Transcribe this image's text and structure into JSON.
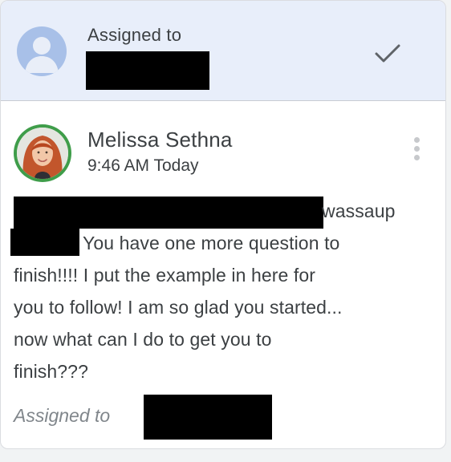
{
  "header": {
    "assigned_label": "Assigned to",
    "avatar_icon": "person-icon",
    "done_icon": "checkmark-icon"
  },
  "comment": {
    "author": "Melissa Sethna",
    "timestamp": "9:46 AM Today",
    "more_icon": "more-vert-icon",
    "message_lines": [
      " wassaup",
      "You have one more question to",
      "finish!!!! I put the example in here for",
      "you to follow! I am so glad you started...",
      "now what can I do to get you to",
      "finish???"
    ],
    "footer_assigned": "Assigned to"
  },
  "colors": {
    "header_bg": "#e8eefa",
    "avatar_ring": "#3f9d4a",
    "default_avatar": "#a8c0e8",
    "text": "#3c4043",
    "muted_text": "#80868b"
  }
}
